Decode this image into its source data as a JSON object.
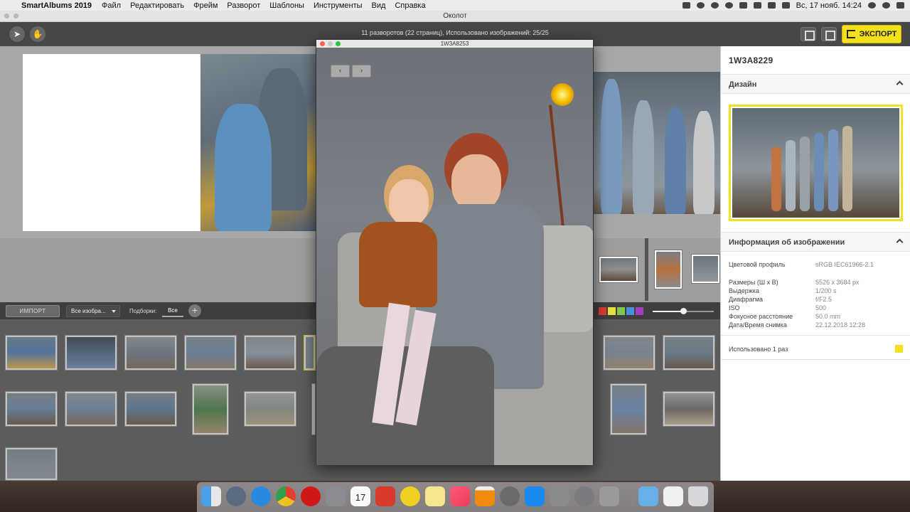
{
  "menubar": {
    "app_name": "SmartAlbums 2019",
    "items": [
      "Файл",
      "Редактировать",
      "Фрейм",
      "Разворот",
      "Шаблоны",
      "Инструменты",
      "Вид",
      "Справка"
    ],
    "clock": "Вс, 17 нояб. 14:24"
  },
  "window": {
    "title": "Околот"
  },
  "toolbar": {
    "info": "11 разворотов (22 страниц), Использовано изображений: 25/25",
    "export_label": "ЭКСПОРТ"
  },
  "library": {
    "import_label": "ИМПОРТ",
    "filter_value": "Все изобра...",
    "collections_label": "Подборки:",
    "tab_all": "Все",
    "add_symbol": "+",
    "color_labels": [
      "#e03a3a",
      "#e8e040",
      "#7ec850",
      "#4a90d9",
      "#a040c0"
    ]
  },
  "preview": {
    "title": "1W3A8253",
    "prev_symbol": "‹",
    "next_symbol": "›"
  },
  "panel": {
    "image_name": "1W3A8229",
    "design_title": "Дизайн",
    "info_title": "Информация об изображении",
    "info": [
      {
        "label": "Цветовой профиль",
        "value": "sRGB IEC61966-2.1"
      },
      {
        "label": "Размеры (Ш x В)",
        "value": "5526 x 3684 px"
      },
      {
        "label": "Выдержка",
        "value": "1/200 s"
      },
      {
        "label": "Диафрагма",
        "value": "f/F2.5"
      },
      {
        "label": "ISO",
        "value": "500"
      },
      {
        "label": "Фокусное расстояние",
        "value": "50.0 mm"
      },
      {
        "label": "Дата/Время снимка",
        "value": "22.12.2018 12:28"
      }
    ],
    "used_text": "Использовано 1 раз"
  },
  "dock": {
    "icons": [
      "finder-icon",
      "launchpad-icon",
      "safari-icon",
      "chrome-icon",
      "opera-icon",
      "rocket-icon",
      "calendar-icon",
      "presentation-icon",
      "smartalbums-icon",
      "notes-icon",
      "music-icon",
      "vlc-icon",
      "photo-slideshow-icon",
      "app-store-icon",
      "calculator-icon",
      "system-preferences-icon",
      "preview-icon",
      "downloads-folder-icon",
      "screenshot-icon",
      "trash-icon"
    ],
    "calendar_day": "17"
  }
}
